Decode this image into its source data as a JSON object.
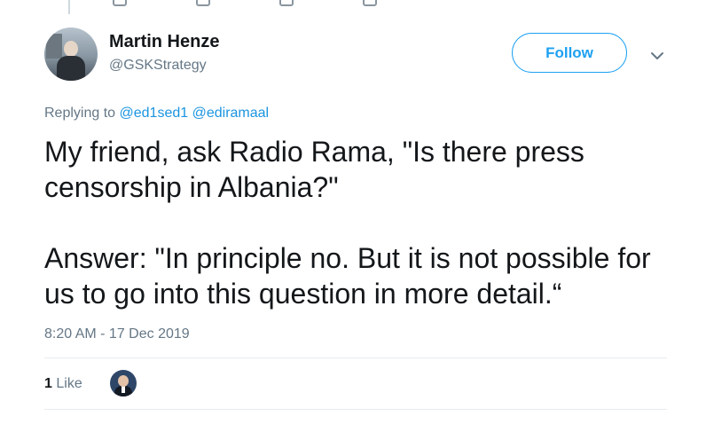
{
  "author": {
    "name": "Martin Henze",
    "handle": "@GSKStrategy"
  },
  "follow_label": "Follow",
  "reply": {
    "prefix": "Replying to ",
    "mentions": [
      "@ed1sed1",
      "@ediramaal"
    ]
  },
  "tweet": {
    "text": "My friend, ask Radio Rama, \"Is there press censorship in Albania?\"\n\nAnswer: \"In principle no. But it is not possible for us to go into this question in more detail.“"
  },
  "timestamp": "8:20 AM - 17 Dec 2019",
  "stats": {
    "likes_count": "1",
    "likes_label": "Like"
  },
  "icons": {
    "menu": "chevron-down-icon"
  },
  "colors": {
    "accent": "#1da1f2",
    "link": "#1b95e0",
    "muted": "#657786",
    "text": "#14171a"
  }
}
